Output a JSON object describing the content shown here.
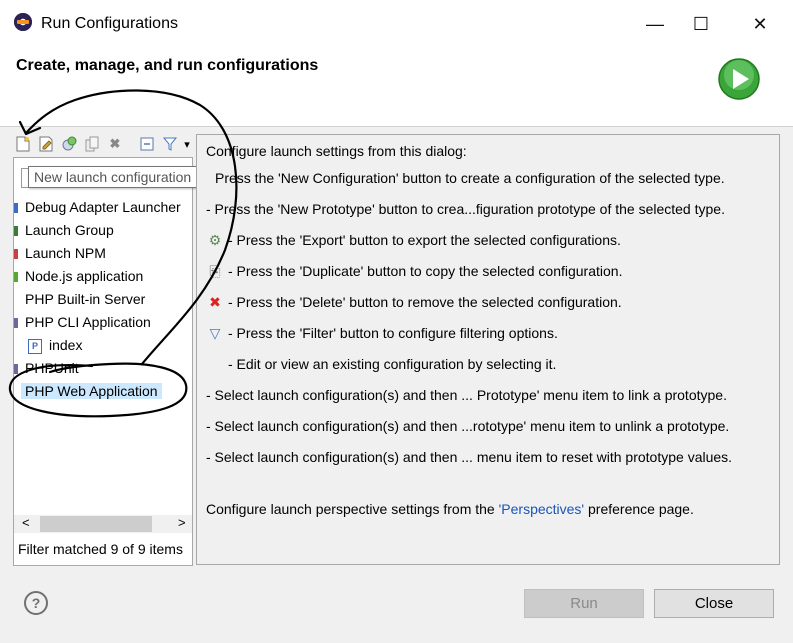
{
  "window": {
    "title": "Run Configurations",
    "minimize_glyph": "—",
    "maximize_glyph": "☐",
    "close_glyph": "✕"
  },
  "header": {
    "title": "Create, manage, and run configurations",
    "icon": "run-icon",
    "accent_color": "#3aa63a"
  },
  "toolbar": {
    "buttons": [
      {
        "name": "new-launch-configuration-icon",
        "glyph": "📄"
      },
      {
        "name": "new-prototype-icon",
        "glyph": "📝"
      },
      {
        "name": "export-icon",
        "glyph": "⚙"
      },
      {
        "name": "duplicate-icon",
        "glyph": "⎘"
      },
      {
        "name": "delete-icon",
        "glyph": "✖"
      },
      {
        "name": "collapse-all-icon",
        "glyph": "⊟"
      },
      {
        "name": "filter-icon",
        "glyph": "▽"
      },
      {
        "name": "view-menu-icon",
        "glyph": "▾"
      }
    ]
  },
  "tooltip": {
    "text": "New launch configuration"
  },
  "tree": {
    "items": [
      {
        "label": "Debug Adapter Launcher",
        "color": "#3b6bc4"
      },
      {
        "label": "Launch Group",
        "color": "#3a7a3a"
      },
      {
        "label": "Launch NPM",
        "color": "#c84040"
      },
      {
        "label": "Node.js application",
        "color": "#5aa632"
      },
      {
        "label": "PHP Built-in Server",
        "color": "#ffffff"
      },
      {
        "label": "PHP CLI Application",
        "color": "#6a6a9a"
      },
      {
        "label": "index",
        "color": "#3b6bc4",
        "child": true,
        "glyph": "P"
      },
      {
        "label": "PHPUnit",
        "color": "#6a6a9a"
      },
      {
        "label": "PHP Web Application",
        "color": "#ffffff",
        "selected": true
      }
    ],
    "filter_status": "Filter matched 9 of 9 items",
    "scroll_left": "<",
    "scroll_right": ">"
  },
  "content": {
    "intro": "Configure launch settings from this dialog:",
    "lines": [
      {
        "icon": "new-configuration-icon",
        "glyph": "",
        "text": "Press the 'New Configuration' button to create a configuration of the selected type."
      },
      {
        "icon": "new-prototype-icon",
        "glyph": "",
        "text": "- Press the 'New Prototype' button to crea...figuration prototype of the selected type."
      },
      {
        "icon": "export-icon",
        "glyph": "⚙",
        "text": "- Press the 'Export' button to export the selected configurations."
      },
      {
        "icon": "duplicate-icon",
        "glyph": "⎘",
        "text": "- Press the 'Duplicate' button to copy the selected configuration."
      },
      {
        "icon": "delete-icon",
        "glyph": "✖",
        "text": "- Press the 'Delete' button to remove the selected configuration."
      },
      {
        "icon": "filter-icon",
        "glyph": "▽",
        "text": "- Press the 'Filter' button to configure filtering options."
      },
      {
        "icon": "",
        "glyph": "",
        "text": "- Edit or view an existing configuration by selecting it."
      },
      {
        "icon": "",
        "glyph": "",
        "text": "- Select launch configuration(s) and then ... Prototype' menu item to link a prototype."
      },
      {
        "icon": "",
        "glyph": "",
        "text": "- Select launch configuration(s) and then ...rototype' menu item to unlink a prototype."
      },
      {
        "icon": "",
        "glyph": "",
        "text": "- Select launch configuration(s) and then ... menu item to reset with prototype values."
      }
    ],
    "perspective_prefix": "Configure launch perspective settings from the ",
    "perspective_link": "'Perspectives'",
    "perspective_suffix": " preference page."
  },
  "footer": {
    "help_glyph": "?",
    "run_label": "Run",
    "close_label": "Close"
  }
}
